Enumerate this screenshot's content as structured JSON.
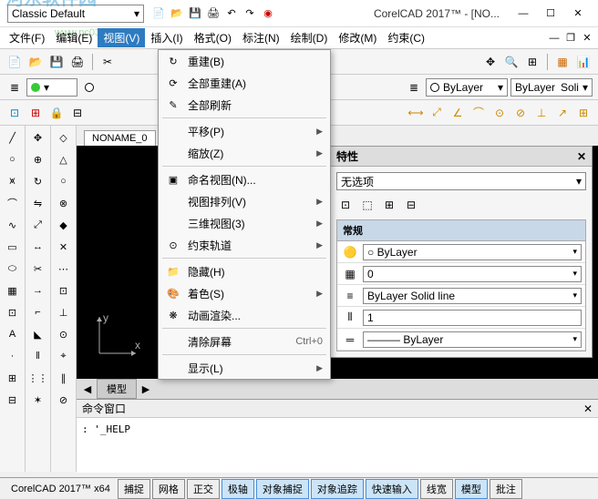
{
  "title": {
    "workspace": "Classic Default",
    "app": "CorelCAD 2017™ - [NO..."
  },
  "watermark": {
    "logo": "河东软件园",
    "url": "www.pc0359.cn"
  },
  "menu": {
    "file": "文件(F)",
    "edit": "编辑(E)",
    "view": "视图(V)",
    "insert": "插入(I)",
    "format": "格式(O)",
    "annotate": "标注(N)",
    "draw": "绘制(D)",
    "modify": "修改(M)",
    "constrain": "约束(C)"
  },
  "dropdown": [
    {
      "icon": "↻",
      "label": "重建(B)"
    },
    {
      "icon": "⟳",
      "label": "全部重建(A)"
    },
    {
      "icon": "✎",
      "label": "全部刷新"
    },
    {
      "sep": true
    },
    {
      "icon": "",
      "label": "平移(P)",
      "arrow": true
    },
    {
      "icon": "",
      "label": "缩放(Z)",
      "arrow": true
    },
    {
      "sep": true
    },
    {
      "icon": "▣",
      "label": "命名视图(N)..."
    },
    {
      "icon": "",
      "label": "视图排列(V)",
      "arrow": true
    },
    {
      "icon": "",
      "label": "三维视图(3)",
      "arrow": true
    },
    {
      "icon": "⊙",
      "label": "约束轨道",
      "arrow": true
    },
    {
      "sep": true
    },
    {
      "icon": "📁",
      "label": "隐藏(H)"
    },
    {
      "icon": "🎨",
      "label": "着色(S)",
      "arrow": true
    },
    {
      "icon": "❋",
      "label": "动画渲染..."
    },
    {
      "sep": true
    },
    {
      "icon": "",
      "label": "清除屏幕",
      "shortcut": "Ctrl+0"
    },
    {
      "sep": true
    },
    {
      "icon": "",
      "label": "显示(L)",
      "arrow": true
    }
  ],
  "layer": {
    "name": "0",
    "bylayer": "ByLayer",
    "bylayer2": "ByLayer",
    "solid": "Soli"
  },
  "doc": {
    "tab": "NONAME_0"
  },
  "model_tabs": {
    "m": "模型"
  },
  "cmd": {
    "title": "命令窗口",
    "text": ": '_HELP"
  },
  "props": {
    "title": "特性",
    "sel": "无选项",
    "section": "常规",
    "rows": [
      {
        "icon": "🟡",
        "val": "○ ByLayer",
        "dd": true
      },
      {
        "icon": "▦",
        "val": "0",
        "dd": true
      },
      {
        "icon": "≡",
        "val": "ByLayer    Solid line",
        "dd": true
      },
      {
        "icon": "⦀",
        "val": "1"
      },
      {
        "icon": "═",
        "val": "——— ByLayer",
        "dd": true
      }
    ]
  },
  "status": {
    "label": "CorelCAD 2017™ x64",
    "btns": [
      {
        "t": "捕捉"
      },
      {
        "t": "网格"
      },
      {
        "t": "正交"
      },
      {
        "t": "极轴",
        "a": true
      },
      {
        "t": "对象捕捉",
        "a": true
      },
      {
        "t": "对象追踪",
        "a": true
      },
      {
        "t": "快速输入",
        "a": true
      },
      {
        "t": "线宽"
      },
      {
        "t": "模型",
        "a": true
      },
      {
        "t": "批注"
      }
    ]
  }
}
